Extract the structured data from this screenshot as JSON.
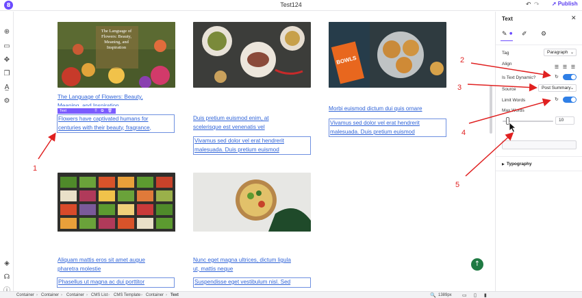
{
  "topbar": {
    "logo_icon": "app-logo-icon",
    "title": "Test124",
    "publish_label": "Publish"
  },
  "rail_icons": [
    "add-icon",
    "layout-icon",
    "components-icon",
    "pages-icon",
    "typography-icon",
    "settings-icon",
    "layers-icon",
    "support-icon",
    "info-icon"
  ],
  "cards": [
    {
      "image": "flowers-book-cover",
      "image_text": [
        "The Language of",
        "Flowers: Beauty,",
        "Meaning, and",
        "Inspiration"
      ],
      "title_lines": [
        "The Language of Flowers: Beauty,",
        "Meaning, and Inspiration"
      ],
      "body_lines": [
        "Flowers have captivated humans for",
        "centuries with their beauty, fragrance,"
      ]
    },
    {
      "image": "food-plates",
      "title_lines": [
        "Duis pretium euismod enim, at",
        "scelerisque est venenatis vel"
      ],
      "body_lines": [
        "Vivamus sed dolor vel erat hendrerit",
        "malesuada. Duis pretium euismod"
      ]
    },
    {
      "image": "bowls-menu",
      "image_text": [
        "BOWLS"
      ],
      "title_lines": [
        "Morbi euismod dictum dui quis ornare"
      ],
      "body_lines": [
        "Vivamus sed dolor vel erat hendrerit",
        "malesuada. Duis pretium euismod"
      ]
    },
    {
      "image": "salad-bar",
      "title_lines": [
        "Aliquam mattis eros sit amet augue",
        "pharetra molestie"
      ],
      "body_lines": [
        "Phasellus ut magna ac dui porttitor"
      ]
    },
    {
      "image": "pasta-bowl",
      "title_lines": [
        "Nunc eget magna ultrices, dictum ligula",
        "ut, mattis neque"
      ],
      "body_lines": [
        "Suspendisse eget vestibulum nisl. Sed"
      ]
    }
  ],
  "selection": {
    "label": "Text",
    "tools": "⠿ ⧉ 🗑"
  },
  "breadcrumbs": [
    "Container",
    "Container",
    "Container",
    "CMS List",
    "CMS Template",
    "Container",
    "Text"
  ],
  "zoom": "1389px",
  "panel": {
    "title": "Text",
    "tabs": [
      "pencil-icon",
      "brush-icon",
      "gear-icon"
    ],
    "tag_label": "Tag",
    "tag_value": "Paragraph",
    "align_label": "Align",
    "dynamic_label": "Is Text Dynamic?",
    "dynamic_on": true,
    "source_label": "Source",
    "source_value": "Post Summary",
    "limit_label": "Limit Words",
    "limit_on": true,
    "max_words_label": "Max Words",
    "max_words_value": "10",
    "max_words_fraction": 0.1,
    "typography_label": "Typography"
  },
  "annotations": [
    "1",
    "2",
    "3",
    "4",
    "5"
  ],
  "colors": {
    "accent": "#6b4bff",
    "link": "#2f63d8",
    "toggle": "#2f7fe6",
    "annotation": "#e02020",
    "fab": "#1f7a43"
  }
}
